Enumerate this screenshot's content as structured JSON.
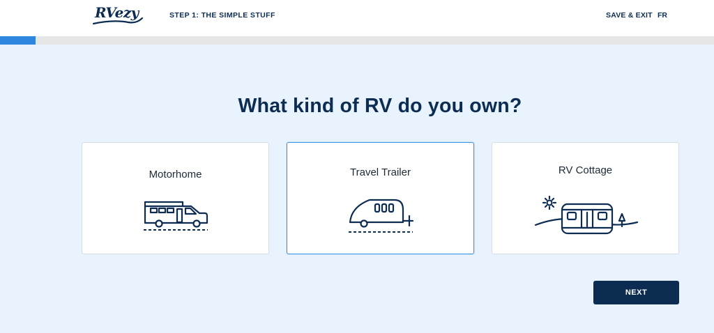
{
  "header": {
    "logo_text": "RVezy",
    "step_label": "STEP 1: THE SIMPLE STUFF",
    "save_exit_label": "SAVE & EXIT",
    "language_label": "FR"
  },
  "progress": {
    "fraction": 0.05
  },
  "main": {
    "title": "What kind of RV do you own?",
    "options": [
      {
        "label": "Motorhome",
        "icon": "motorhome-icon",
        "selected": false
      },
      {
        "label": "Travel Trailer",
        "icon": "travel-trailer-icon",
        "selected": true
      },
      {
        "label": "RV Cottage",
        "icon": "rv-cottage-icon",
        "selected": false
      }
    ],
    "next_label": "NEXT"
  },
  "colors": {
    "navy": "#0c2c52",
    "accent_blue": "#3a95e6",
    "background": "#e8f3fd"
  }
}
